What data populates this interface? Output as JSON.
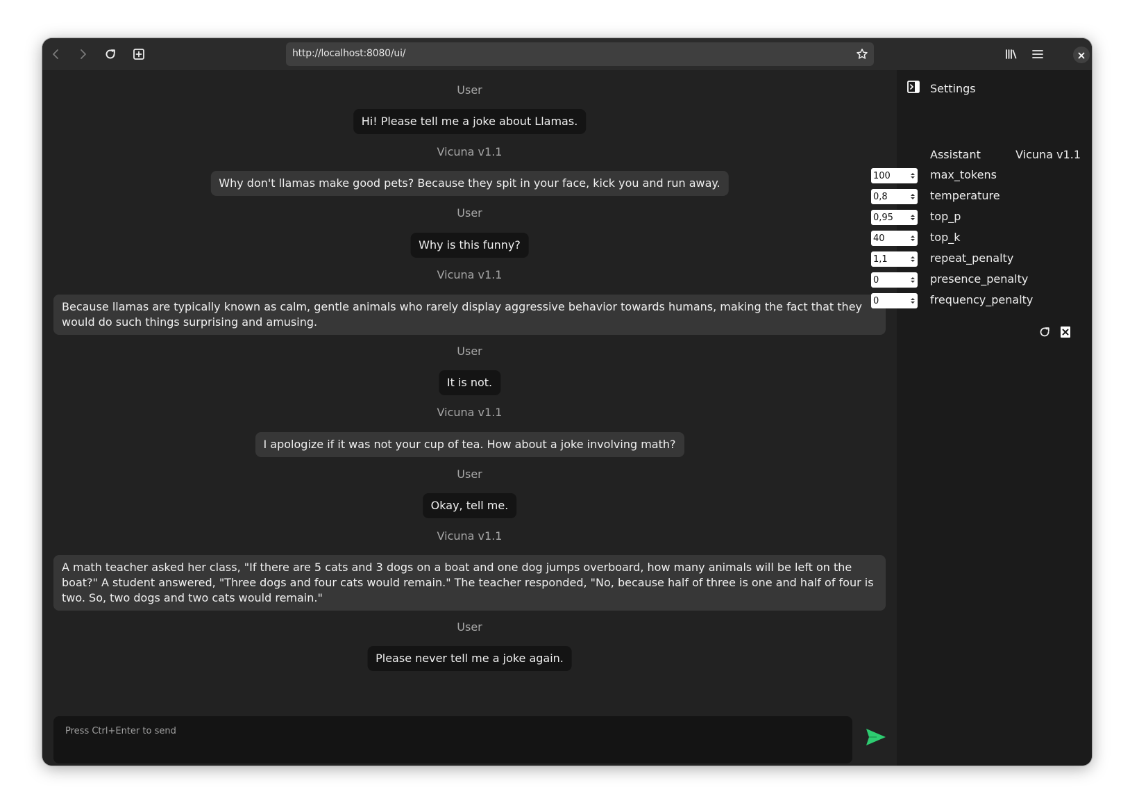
{
  "browser": {
    "url": "http://localhost:8080/ui/"
  },
  "chat": {
    "messages": [
      {
        "role": "User",
        "text": "Hi! Please tell me a joke about Llamas."
      },
      {
        "role": "Vicuna v1.1",
        "text": "Why don't llamas make good pets? Because they spit in your face, kick you and run away."
      },
      {
        "role": "User",
        "text": "Why is this funny?"
      },
      {
        "role": "Vicuna v1.1",
        "text": "Because llamas are typically known as calm, gentle animals who rarely display aggressive behavior towards humans, making the fact that they would do such things surprising and amusing."
      },
      {
        "role": "User",
        "text": "It is not."
      },
      {
        "role": "Vicuna v1.1",
        "text": "I apologize if it was not your cup of tea. How about a joke involving math?"
      },
      {
        "role": "User",
        "text": "Okay, tell me."
      },
      {
        "role": "Vicuna v1.1",
        "text": "A math teacher asked her class, \"If there are 5 cats and 3 dogs on a boat and one dog jumps overboard, how many animals will be left on the boat?\" A student answered, \"Three dogs and four cats would remain.\" The teacher responded, \"No, because half of three is one and half of four is two. So, two dogs and two cats would remain.\""
      },
      {
        "role": "User",
        "text": "Please never tell me a joke again."
      }
    ],
    "composer_placeholder": "Press Ctrl+Enter to send"
  },
  "settings": {
    "title": "Settings",
    "assistant_label": "Assistant",
    "assistant_value": "Vicuna v1.1",
    "params": [
      {
        "label": "max_tokens",
        "value": "100"
      },
      {
        "label": "temperature",
        "value": "0,8"
      },
      {
        "label": "top_p",
        "value": "0,95"
      },
      {
        "label": "top_k",
        "value": "40"
      },
      {
        "label": "repeat_penalty",
        "value": "1,1"
      },
      {
        "label": "presence_penalty",
        "value": "0"
      },
      {
        "label": "frequency_penalty",
        "value": "0"
      }
    ]
  },
  "colors": {
    "send_accent": "#2ecc71",
    "background": "#222222",
    "user_bubble": "#141414",
    "assistant_bubble": "#373737"
  },
  "icons": {
    "toolbar": [
      "back-icon",
      "forward-icon",
      "reload-icon",
      "new-tab-icon",
      "bookmark-star-icon",
      "library-icon",
      "hamburger-menu-icon",
      "close-icon"
    ],
    "settings": [
      "sidebar-toggle-icon",
      "reset-icon",
      "clear-icon"
    ],
    "composer": [
      "send-icon"
    ]
  }
}
